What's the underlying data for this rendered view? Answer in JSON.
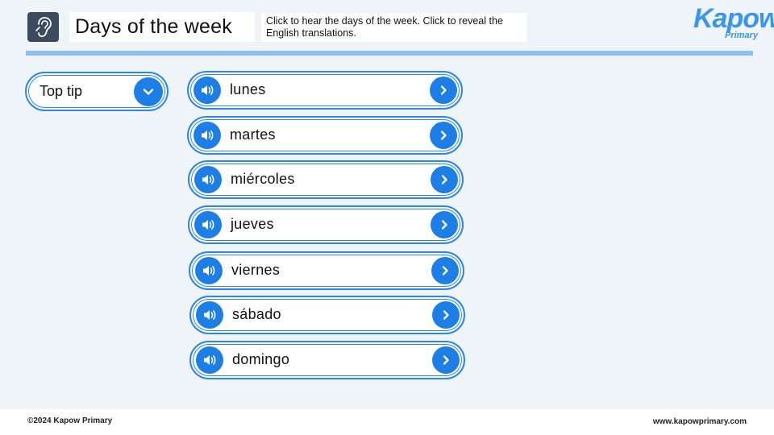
{
  "header": {
    "icon": "ear-icon",
    "title": "Days of the week",
    "instructions": "Click to hear the days of the week. Click to reveal the English translations."
  },
  "logo": {
    "main": "Kapow",
    "sub": "Primary"
  },
  "tip": {
    "label": "Top tip",
    "icon": "chevron-down-icon"
  },
  "days": [
    {
      "label": "lunes"
    },
    {
      "label": "martes"
    },
    {
      "label": "miércoles"
    },
    {
      "label": "jueves"
    },
    {
      "label": "viernes"
    },
    {
      "label": "sábado"
    },
    {
      "label": "domingo"
    }
  ],
  "icons": {
    "audio": "speaker-icon",
    "reveal": "chevron-right-icon"
  },
  "colors": {
    "accent": "#1d7ee6",
    "border": "#2e86e6",
    "background": "#eef4f8",
    "header_icon_bg": "#3b4a5c",
    "divider": "#8ec0f3"
  },
  "footer": {
    "copyright": "©2024 Kapow Primary",
    "url": "www.kapowprimary.com"
  }
}
